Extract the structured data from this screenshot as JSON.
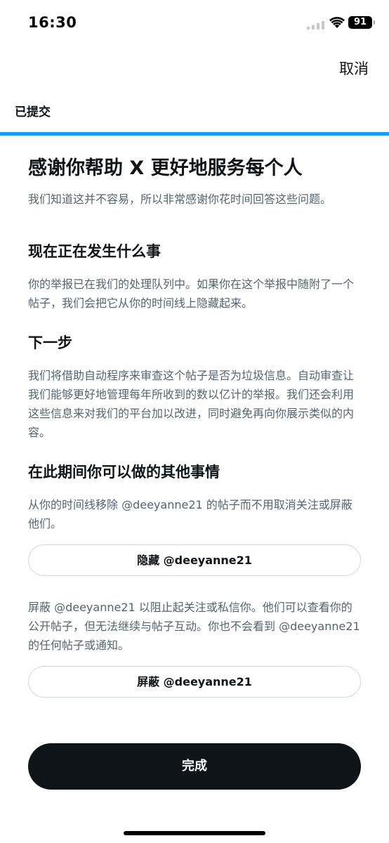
{
  "status_bar": {
    "time": "16:30",
    "battery_level": "91",
    "signal_icon": "cellular-signal-icon",
    "wifi_icon": "wifi-icon"
  },
  "header": {
    "cancel_label": "取消",
    "tab_label": "已提交",
    "progress": 1.0,
    "accent_color": "#1d9bf0"
  },
  "main": {
    "title": "感谢你帮助 X 更好地服务每个人",
    "intro": "我们知道这并不容易，所以非常感谢你花时间回答这些问题。",
    "sections": [
      {
        "heading": "现在正在发生什么事",
        "text": "你的举报已在我们的处理队列中。如果你在这个举报中随附了一个帖子，我们会把它从你的时间线上隐藏起来。"
      },
      {
        "heading": "下一步",
        "text": "我们将借助自动程序来审查这个帖子是否为垃圾信息。自动审查让我们能够更好地管理每年所收到的数以亿计的举报。我们还会利用这些信息来对我们的平台加以改进，同时避免再向你展示类似的内容。"
      },
      {
        "heading": "在此期间你可以做的其他事情",
        "mute_text": "从你的时间线移除 @deeyanne21 的帖子而不用取消关注或屏蔽他们。",
        "mute_button": "隐藏 @deeyanne21",
        "block_text": "屏蔽 @deeyanne21 以阻止起关注或私信你。他们可以查看你的公开帖子，但无法继续与帖子互动。你也不会看到 @deeyanne21 的任何帖子或通知。",
        "block_button": "屏蔽 @deeyanne21"
      }
    ]
  },
  "footer": {
    "done_label": "完成"
  }
}
